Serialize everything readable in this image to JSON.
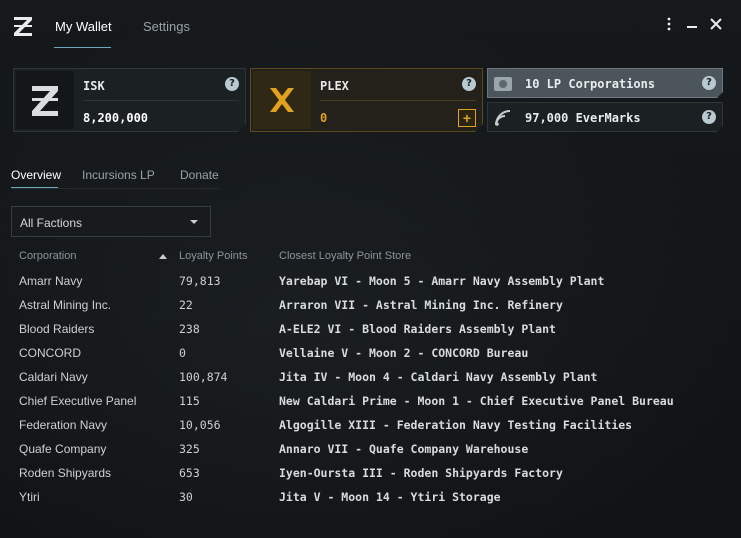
{
  "header": {
    "tabs": [
      {
        "label": "My Wallet",
        "active": true
      },
      {
        "label": "Settings",
        "active": false
      }
    ]
  },
  "currencies": {
    "isk": {
      "name": "ISK",
      "amount": "8,200,000"
    },
    "plex": {
      "name": "PLEX",
      "amount": "0"
    }
  },
  "side": {
    "lp_label": "10 LP Corporations",
    "evermarks_label": "97,000 EverMarks"
  },
  "subtabs": [
    {
      "label": "Overview",
      "active": true
    },
    {
      "label": "Incursions LP",
      "active": false
    },
    {
      "label": "Donate",
      "active": false
    }
  ],
  "filter": {
    "selected": "All Factions"
  },
  "table": {
    "headers": {
      "corporation": "Corporation",
      "lp": "Loyalty Points",
      "store": "Closest Loyalty Point Store"
    },
    "rows": [
      {
        "corp": "Amarr Navy",
        "lp": "79,813",
        "store": "Yarebap VI - Moon 5 - Amarr Navy Assembly Plant"
      },
      {
        "corp": "Astral Mining Inc.",
        "lp": "22",
        "store": "Arraron VII - Astral Mining Inc. Refinery"
      },
      {
        "corp": "Blood Raiders",
        "lp": "238",
        "store": "A-ELE2 VI - Blood Raiders Assembly Plant"
      },
      {
        "corp": "CONCORD",
        "lp": "0",
        "store": "Vellaine V - Moon 2 - CONCORD Bureau"
      },
      {
        "corp": "Caldari Navy",
        "lp": "100,874",
        "store": "Jita IV - Moon 4 - Caldari Navy Assembly Plant"
      },
      {
        "corp": "Chief Executive Panel",
        "lp": "115",
        "store": "New Caldari Prime - Moon 1 - Chief Executive Panel Bureau"
      },
      {
        "corp": "Federation Navy",
        "lp": "10,056",
        "store": "Algogille XIII - Federation Navy Testing Facilities"
      },
      {
        "corp": "Quafe Company",
        "lp": "325",
        "store": "Annaro VII - Quafe Company Warehouse"
      },
      {
        "corp": "Roden Shipyards",
        "lp": "653",
        "store": "Iyen-Oursta III - Roden Shipyards Factory"
      },
      {
        "corp": "Ytiri",
        "lp": "30",
        "store": "Jita V - Moon 14 - Ytiri Storage"
      }
    ]
  },
  "colors": {
    "accent": "#6fa8bc",
    "plex": "#e0a21f",
    "background": "#121517"
  },
  "icons": [
    "menu-dots-icon",
    "minimize-icon",
    "close-icon",
    "help-icon",
    "plus-icon",
    "caret-down-icon",
    "sort-ascending-icon",
    "lp-icon",
    "evermarks-icon"
  ]
}
